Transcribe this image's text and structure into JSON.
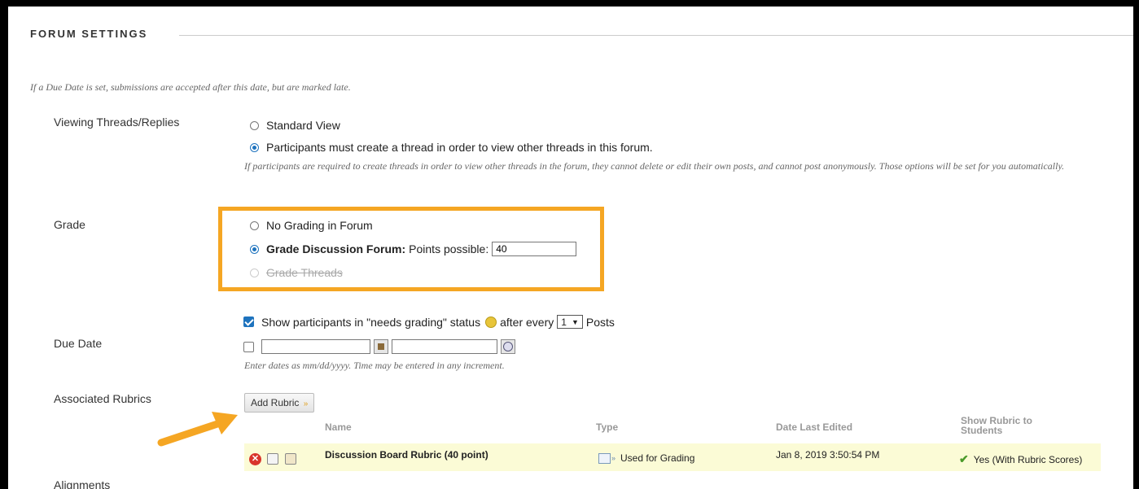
{
  "section": {
    "title": "FORUM SETTINGS"
  },
  "due_note": "If a Due Date is set, submissions are accepted after this date, but are marked late.",
  "viewing": {
    "label": "Viewing Threads/Replies",
    "options": [
      "Standard View",
      "Participants must create a thread in order to view other threads in this forum."
    ],
    "note": "If participants are required to create threads in order to view other threads in the forum, they cannot delete or edit their own posts, and cannot post anonymously. Those options will be set for you automatically."
  },
  "grade": {
    "label": "Grade",
    "no_grading": "No Grading in Forum",
    "grade_forum_bold": "Grade Discussion Forum:",
    "points_label": "Points possible:",
    "points_value": "40",
    "grade_threads": "Grade Threads",
    "needs_grading_prefix": "Show participants in \"needs grading\" status",
    "after_every": "after every",
    "after_every_value": "1",
    "posts": "Posts"
  },
  "due_date": {
    "label": "Due Date",
    "note": "Enter dates as mm/dd/yyyy. Time may be entered in any increment."
  },
  "rubrics": {
    "label": "Associated Rubrics",
    "add_button": "Add Rubric",
    "headers": {
      "name": "Name",
      "type": "Type",
      "date": "Date Last Edited",
      "show": "Show Rubric to Students"
    },
    "rows": [
      {
        "name": "Discussion Board Rubric (40 point)",
        "type": "Used for Grading",
        "date": "Jan 8, 2019 3:50:54 PM",
        "show": "Yes (With Rubric Scores)"
      }
    ]
  },
  "alignments": {
    "label": "Alignments"
  },
  "colors": {
    "highlight": "#f5a623",
    "accent": "#1e73be",
    "row_bg": "#fbfbd6"
  }
}
